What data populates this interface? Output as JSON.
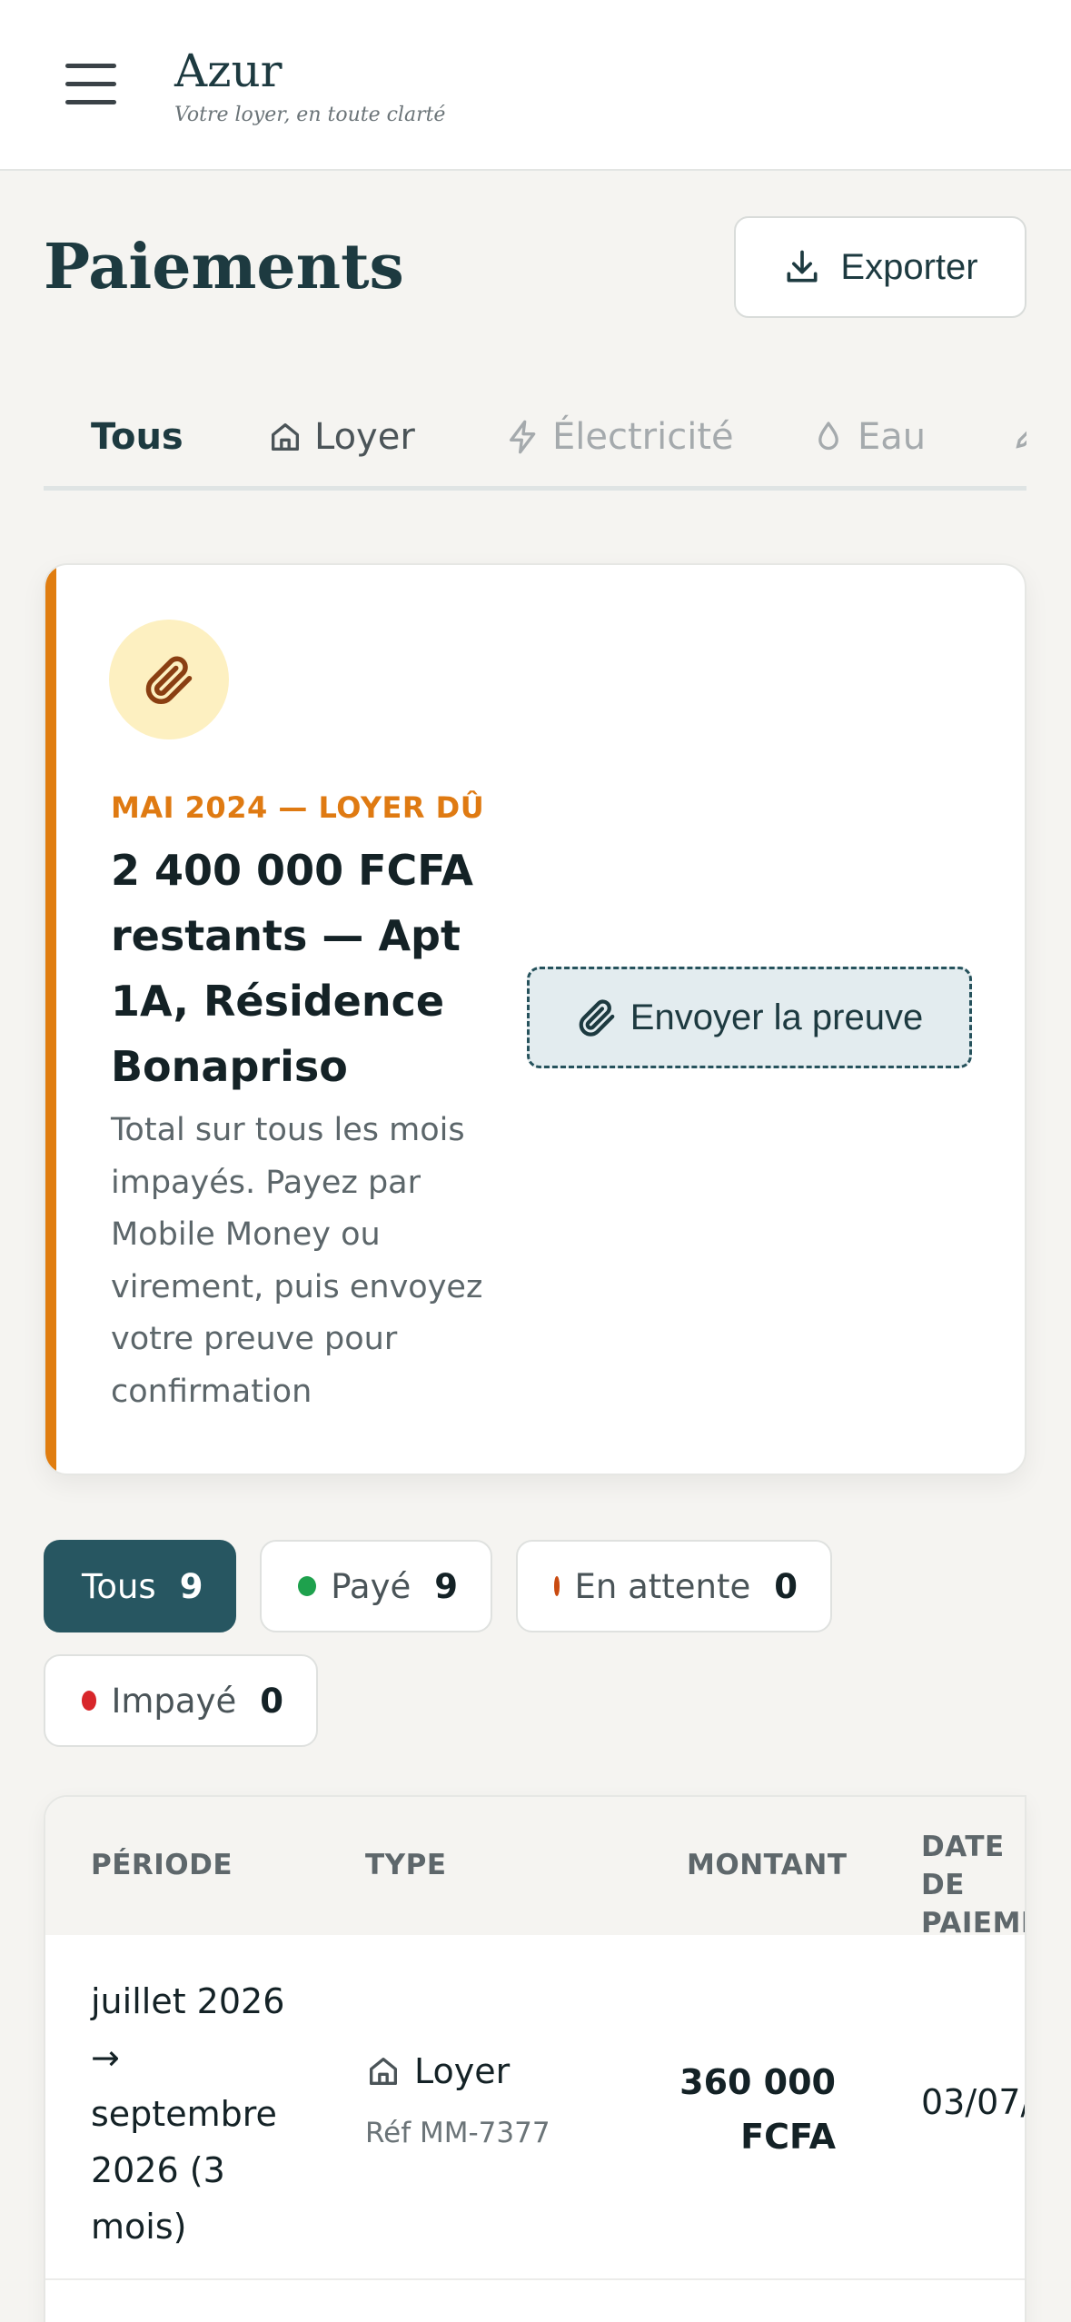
{
  "header": {
    "brand": "Azur",
    "tagline": "Votre loyer, en toute clarté"
  },
  "page": {
    "title": "Paiements",
    "export_label": "Exporter"
  },
  "tabs": [
    {
      "label": "Tous",
      "icon": "none",
      "state": "active"
    },
    {
      "label": "Loyer",
      "icon": "home-icon",
      "state": "enabled"
    },
    {
      "label": "Électricité",
      "icon": "lightning-icon",
      "state": "disabled"
    },
    {
      "label": "Eau",
      "icon": "droplet-icon",
      "state": "disabled"
    }
  ],
  "due_card": {
    "eyebrow": "MAI 2024 — LOYER DÛ",
    "title": "2 400 000 FCFA restants — Apt 1A, Résidence Bonapriso",
    "description": "Total sur tous les mois impayés. Payez par Mobile Money ou virement, puis envoyez votre preuve pour confirmation",
    "proof_button": "Envoyer la preuve",
    "accent": "#e07d10"
  },
  "filters": [
    {
      "label": "Tous",
      "count": "9",
      "dot_color": "",
      "active": true
    },
    {
      "label": "Payé",
      "count": "9",
      "dot_color": "#1ea14d",
      "active": false
    },
    {
      "label": "En attente",
      "count": "0",
      "dot_color": "#c94a10",
      "active": false
    },
    {
      "label": "Impayé",
      "count": "0",
      "dot_color": "#d8262a",
      "active": false
    }
  ],
  "table": {
    "columns": [
      "PÉRIODE",
      "TYPE",
      "MONTANT",
      "DATE DE PAIEMENT"
    ],
    "rows": [
      {
        "period": "juillet 2026 → septembre 2026 (3 mois)",
        "type": "Loyer",
        "ref": "Réf MM-7377",
        "amount": "360 000 FCFA",
        "date": "03/07/"
      }
    ]
  },
  "colors": {
    "primary": "#275661",
    "background": "#f5f4f1",
    "accent": "#e07d10"
  }
}
